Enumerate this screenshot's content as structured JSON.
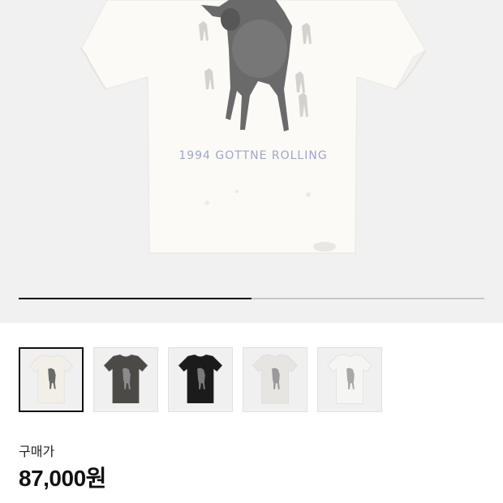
{
  "product": {
    "print_text": "1994 GOTTNE ROLLING",
    "image_icon": "tshirt-goat-print",
    "colors": {
      "shirt": "#fbfaf6",
      "goat": "#6a6a6a",
      "print_text": "#9fa6cc",
      "hero_bg": "#f1f1f1"
    }
  },
  "gallery": {
    "progress": 0.5,
    "thumbnails": [
      {
        "color_name": "white",
        "shirt_color": "#f1efe8",
        "goat_color": "#6a6a6a",
        "selected": true
      },
      {
        "color_name": "charcoal",
        "shirt_color": "#4b4a47",
        "goat_color": "#8b8b8b",
        "selected": false
      },
      {
        "color_name": "black",
        "shirt_color": "#1b1b1b",
        "goat_color": "#7a7a7a",
        "selected": false
      },
      {
        "color_name": "light-gray",
        "shirt_color": "#e6e5e1",
        "goat_color": "#9a9a9a",
        "selected": false
      },
      {
        "color_name": "off-white",
        "shirt_color": "#f5f5f3",
        "goat_color": "#a8a8a8",
        "selected": false
      }
    ]
  },
  "price": {
    "label": "구매가",
    "value": "87,000원"
  }
}
